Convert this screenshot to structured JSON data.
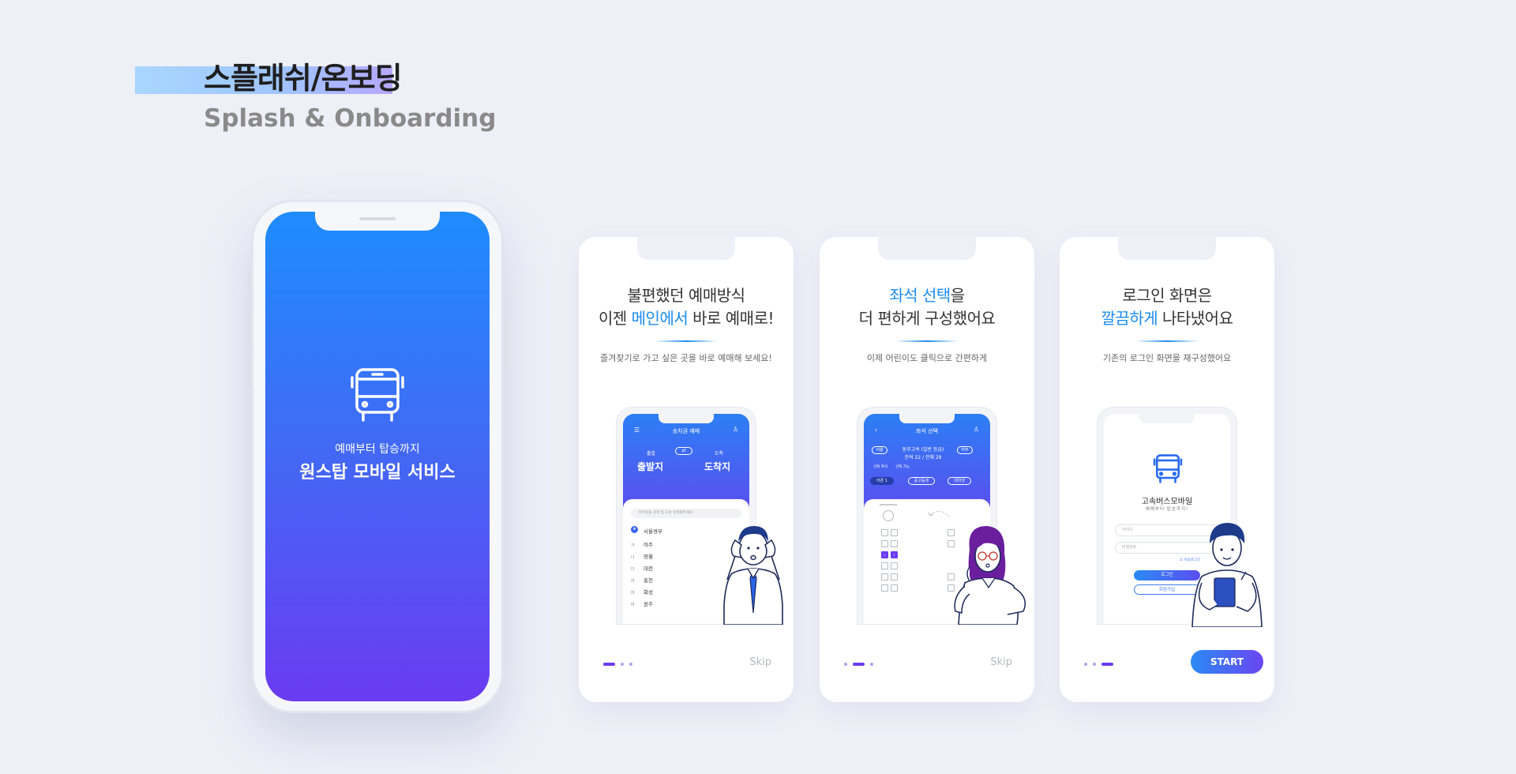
{
  "header": {
    "title": "스플래쉬/온보딩",
    "subtitle": "Splash & Onboarding"
  },
  "splash": {
    "tagline": "예매부터 탑승까지",
    "service_name": "원스탑 모바일 서비스",
    "icon": "bus-icon",
    "gradient": [
      "#1e8cff",
      "#6a3bf2"
    ]
  },
  "onboarding": [
    {
      "headline_line1": "불편했던 예매방식",
      "headline_line2_pre": "이젠 ",
      "headline_line2_hl": "메인에서",
      "headline_line2_post": " 바로 예매로!",
      "description": "즐겨찾기로 가고 싶은 곳을 바로 예매해 보세요!",
      "action_label": "Skip",
      "active_dot": 0,
      "mock": {
        "title": "승차권 예매",
        "from_label": "출발",
        "to_label": "도착",
        "from": "출발지",
        "to": "도착지",
        "swap": "⇄",
        "search_placeholder": "터미널을 검색 및 초성 검색해주세요!",
        "favorite": "서울경부",
        "list": [
          {
            "key": "가",
            "name": "여주"
          },
          {
            "key": "나",
            "name": "영월"
          },
          {
            "key": "다",
            "name": "대전"
          },
          {
            "key": "라",
            "name": "홍천"
          },
          {
            "key": "마",
            "name": "화성"
          },
          {
            "key": "바",
            "name": "원주"
          }
        ]
      }
    },
    {
      "headline_line1_hl": "좌석 선택",
      "headline_line1_post": "을",
      "headline_line2": "더 편하게 구성했어요",
      "description": "이제 어린이도 클릭으로 간편하게",
      "action_label": "Skip",
      "active_dot": 1,
      "mock": {
        "title": "좌석 선택",
        "from": "서울",
        "to": "여주",
        "route_line1": "동부고속 (일반 등급)",
        "route_line2": "잔여 22 / 전체 29",
        "legend1": "선택 좌석",
        "legend2": "선택 가능",
        "chips": [
          "어른 1",
          "중고등생",
          "대학생"
        ]
      }
    },
    {
      "headline_line1": "로그인 화면은",
      "headline_line2_hl": "깔끔하게",
      "headline_line2_post": " 나타냈어요",
      "description": "기존의 로그인 화면을 재구성했어요",
      "action_label": "START",
      "active_dot": 2,
      "mock": {
        "app_name": "고속버스모바일",
        "app_tagline": "예매부터 탑승까지!",
        "id_placeholder": "아이디",
        "pw_placeholder": "비밀번호",
        "auto_login": "자동로그인",
        "login": "로그인",
        "signup": "회원가입"
      }
    }
  ],
  "colors": {
    "accent": "#1a8bf0",
    "purple": "#6b3cf0",
    "background": "#eef0f8"
  }
}
